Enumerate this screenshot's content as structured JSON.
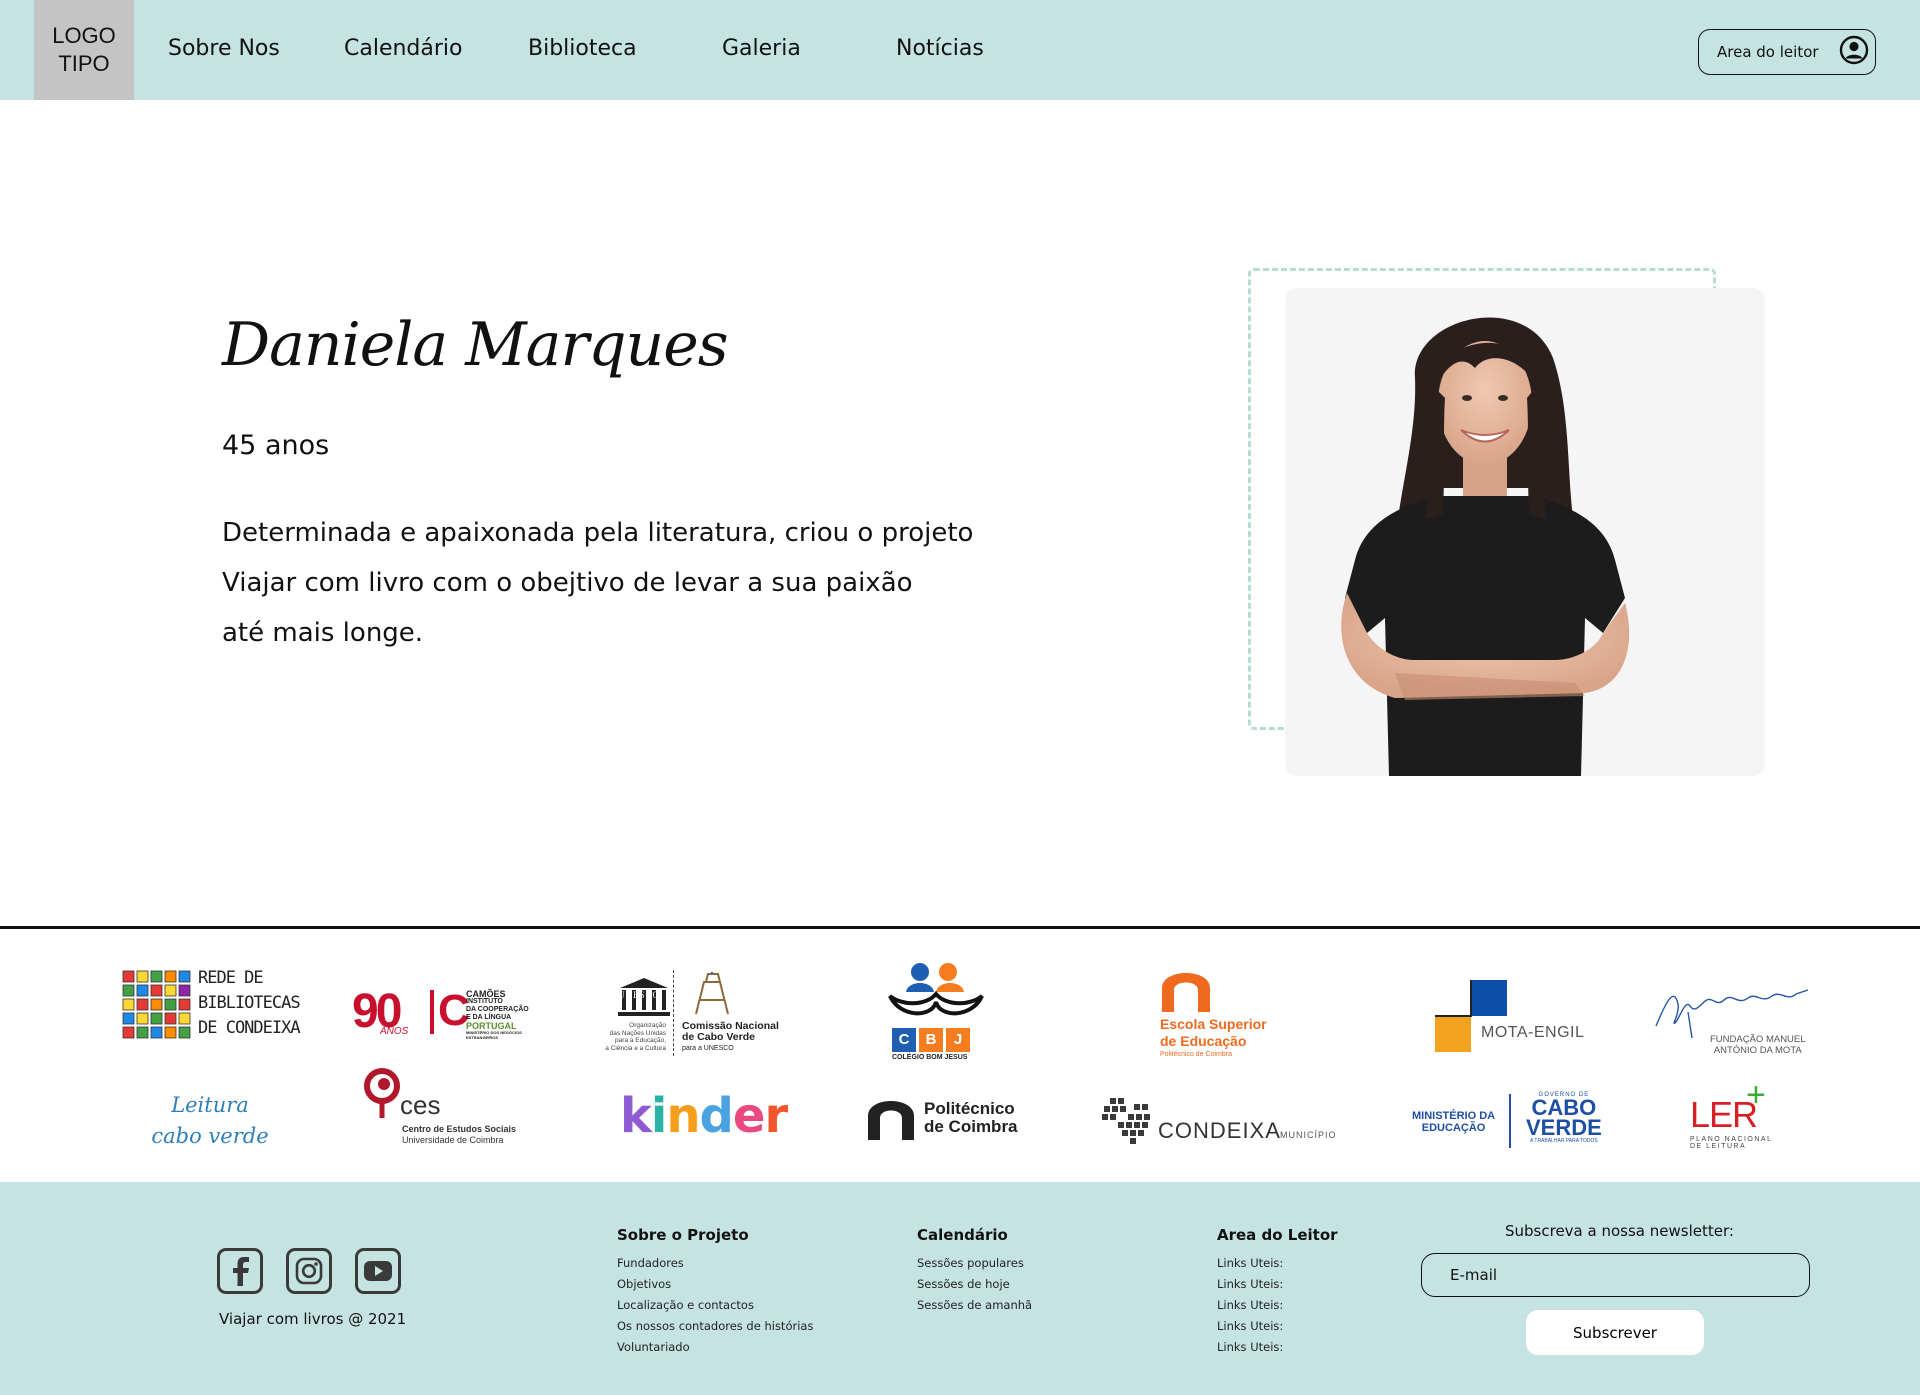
{
  "header": {
    "logo_line1": "LOGO",
    "logo_line2": "TIPO",
    "nav": [
      "Sobre Nos",
      "Calendário",
      "Biblioteca",
      "Galeria",
      "Notícias"
    ],
    "reader_area_label": "Area do leitor",
    "reader_icon": "user-circle-icon"
  },
  "hero": {
    "name": "Daniela Marques",
    "age": "45 anos",
    "bio_lines": [
      "Determinada e apaixonada pela literatura, criou o projeto",
      "Viajar com livro com o obejtivo de levar a sua paixão",
      "até mais longe."
    ],
    "photo": "smiling-woman-arms-crossed"
  },
  "partners": {
    "rede": {
      "line1": "Rede de",
      "line2": "Bibliotecas",
      "line3": "de Condeixa"
    },
    "camoes": {
      "years": "90",
      "anos": "ANOS",
      "brand": "CAMÕES",
      "sub1": "INSTITUTO",
      "sub2": "DA COOPERAÇÃO",
      "sub3": "E DA LÍNGUA",
      "country": "PORTUGAL",
      "ministry": "MINISTÉRIO DOS NEGÓCIOS ESTRANGEIROS"
    },
    "unesco": {
      "word": "UNESCO",
      "org1": "Organização",
      "org2": "das Nações Unidas",
      "org3": "para a Educação,",
      "org4": "a Ciência e a Cultura",
      "cn1": "Comissão Nacional",
      "cn2": "de Cabo Verde",
      "cn3": "para a UNESCO"
    },
    "cbj": {
      "letters": [
        "C",
        "B",
        "J"
      ],
      "name": "COLÉGIO BOM JESUS"
    },
    "escola": {
      "line1": "Escola Superior",
      "line2": "de Educação",
      "line3": "Politécnico de Coimbra"
    },
    "mota": {
      "name": "MOTA-ENGIL"
    },
    "fundacao": {
      "line1": "FUNDAÇÃO MANUEL",
      "line2": "ANTÓNIO DA MOTA"
    },
    "leitura": {
      "line1": "Leitura",
      "line2": "cabo verde"
    },
    "ces": {
      "abbr": "ces",
      "line1": "Centro de Estudos Sociais",
      "line2": "Universidade de Coimbra"
    },
    "kinder": {
      "letters": [
        "k",
        "i",
        "n",
        "d",
        "e",
        "r"
      ]
    },
    "politecnico": {
      "line1": "Politécnico",
      "line2": "de Coimbra"
    },
    "condeixa": {
      "name": "CONDEIXA",
      "sub": "MUNICÍPIO"
    },
    "ministerio": {
      "line1": "MINISTÉRIO DA",
      "line2": "EDUCAÇÃO",
      "gov": "GOVERNO DE",
      "cabo": "CABO",
      "verde": "VERDE",
      "tag": "A TRABALHAR PARA TODOS"
    },
    "ler": {
      "word": "LER",
      "line1": "PLANO NACIONAL",
      "line2": "DE LEITURA"
    }
  },
  "footer": {
    "socials": [
      "facebook-icon",
      "instagram-icon",
      "youtube-icon"
    ],
    "copyright": "Viajar com livros @ 2021",
    "columns": [
      {
        "title": "Sobre o Projeto",
        "links": [
          "Fundadores",
          "Objetivos",
          "Localização e contactos",
          "Os nossos contadores de histórias",
          "Voluntariado"
        ]
      },
      {
        "title": "Calendário",
        "links": [
          "Sessões populares",
          "Sessões de hoje",
          "Sessões de amanhã"
        ]
      },
      {
        "title": "Area do Leitor",
        "links": [
          "Links Uteis:",
          "Links Uteis:",
          "Links Uteis:",
          "Links Uteis:",
          "Links Uteis:"
        ]
      }
    ],
    "newsletter": {
      "title": "Subscreva a nossa newsletter:",
      "email_placeholder": "E-mail",
      "subscribe_label": "Subscrever"
    }
  },
  "colors": {
    "accent_mint": "#c5e3e0",
    "logo_grey": "#c4c4c4",
    "dash_mint": "#b6dcd5"
  }
}
